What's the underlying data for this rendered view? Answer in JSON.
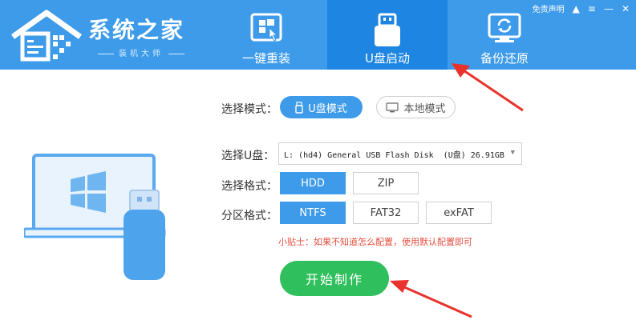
{
  "header": {
    "logo": {
      "title": "系统之家",
      "subtitle": "装机大师"
    },
    "tabs": [
      {
        "label": "一键重装",
        "icon": "windows-cursor-icon"
      },
      {
        "label": "U盘启动",
        "icon": "usb-drive-icon",
        "active": true
      },
      {
        "label": "备份还原",
        "icon": "backup-restore-icon"
      }
    ],
    "top_right": {
      "feedback": "免责声明",
      "icons": [
        "hat-icon",
        "menu-icon",
        "minimize-icon",
        "close-icon"
      ]
    }
  },
  "form": {
    "mode": {
      "label": "选择模式：",
      "options": [
        {
          "label": "U盘模式",
          "icon": "usb-icon",
          "selected": true
        },
        {
          "label": "本地模式",
          "icon": "monitor-icon",
          "selected": false
        }
      ]
    },
    "usb": {
      "label": "选择U盘：",
      "value": "L: (hd4) General USB Flash Disk  (U盘) 26.91GB"
    },
    "format": {
      "label": "选择格式：",
      "options": [
        {
          "label": "HDD",
          "selected": true
        },
        {
          "label": "ZIP",
          "selected": false
        }
      ]
    },
    "partition": {
      "label": "分区格式：",
      "options": [
        {
          "label": "NTFS",
          "selected": true
        },
        {
          "label": "FAT32",
          "selected": false
        },
        {
          "label": "exFAT",
          "selected": false
        }
      ]
    },
    "tip": "小贴士：如果不知道怎么配置，使用默认配置即可",
    "start_button": "开始制作"
  },
  "colors": {
    "header_bg": "#3d9be9",
    "active_tab": "#1e86e2",
    "start_button": "#2fbf5c",
    "tip_text": "#e64d3d",
    "annotation_arrow": "#e8322b"
  }
}
